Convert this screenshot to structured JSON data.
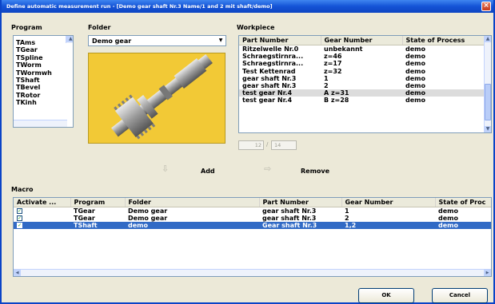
{
  "window": {
    "title": "Define automatic measurement run - [Demo gear shaft Nr.3 Name/1 and 2 mit shaft/demo]",
    "close_glyph": "×"
  },
  "program": {
    "label": "Program",
    "items": [
      "TAms",
      "TGear",
      "TSpline",
      "TWorm",
      "TWormwh",
      "TShaft",
      "TBevel",
      "TRotor",
      "TKinh"
    ],
    "selected_index": 1
  },
  "folder": {
    "label": "Folder",
    "selected": "Demo gear",
    "arrow": "▼"
  },
  "workpiece": {
    "label": "Workpiece",
    "columns": [
      "Part Number",
      "Gear Number",
      "State of Process"
    ],
    "rows": [
      [
        "Ritzelwelle Nr.0",
        "unbekannt",
        "demo"
      ],
      [
        "Schraegstirnra...",
        "z=46",
        "demo"
      ],
      [
        "Schraegstirnra...",
        "z=17",
        "demo"
      ],
      [
        "Test Kettenrad",
        "z=32",
        "demo"
      ],
      [
        "gear shaft Nr.3",
        "1",
        "demo"
      ],
      [
        "gear shaft Nr.3",
        "2",
        "demo"
      ],
      [
        "test gear Nr.4",
        "A z=31",
        "demo"
      ],
      [
        "test gear Nr.4",
        "B z=28",
        "demo"
      ]
    ],
    "highlighted_index": 6,
    "pager_current": "12",
    "pager_separator": "/",
    "pager_total": "14"
  },
  "actions": {
    "add_label": "Add",
    "add_arrow": "⇩",
    "remove_label": "Remove",
    "remove_arrow": "⇨"
  },
  "macro": {
    "label": "Macro",
    "columns": [
      "Activate ...",
      "Program",
      "Folder",
      "Part Number",
      "Gear Number",
      "State of Proc"
    ],
    "rows": [
      {
        "check": "✓",
        "program": "TGear",
        "folder": "Demo gear",
        "part": "gear shaft Nr.3",
        "gear": "1",
        "state": "demo"
      },
      {
        "check": "✓",
        "program": "TGear",
        "folder": "Demo gear",
        "part": "gear shaft Nr.3",
        "gear": "2",
        "state": "demo"
      },
      {
        "check": "✓",
        "program": "TShaft",
        "folder": "demo",
        "part": "Gear shaft Nr.3",
        "gear": "1,2",
        "state": "demo"
      }
    ],
    "selected_index": 2
  },
  "footer": {
    "ok_label": "OK",
    "cancel_label": "Cancel"
  },
  "colors": {
    "selection": "#316ac5",
    "title_bar": "#1453d6",
    "dialog_bg": "#ece9d8"
  }
}
